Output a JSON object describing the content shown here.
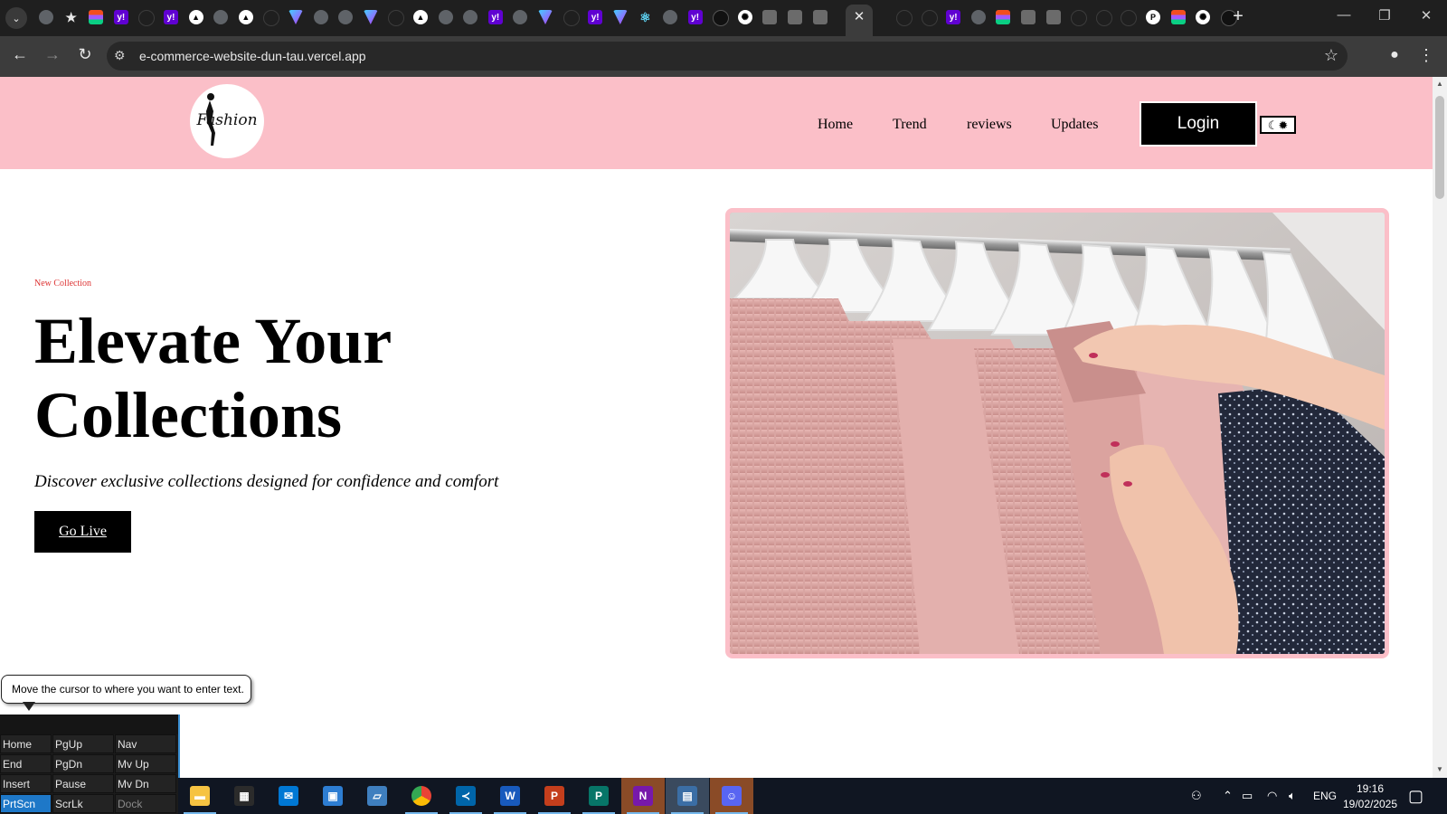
{
  "browser": {
    "url": "e-commerce-website-dun-tau.vercel.app",
    "tab_favicons": [
      "chrome-icon",
      "star-icon",
      "figma-icon",
      "yahoo-icon",
      "blank-icon",
      "yahoo-icon",
      "vercel-icon",
      "chrome-icon",
      "vercel-icon",
      "blank-icon",
      "vite-icon",
      "chrome-icon",
      "chrome-icon",
      "vite-icon",
      "blank-icon",
      "vercel-icon",
      "chrome-icon",
      "chrome-icon",
      "yahoo-icon",
      "chrome-icon",
      "vite-icon",
      "blank-icon",
      "yahoo-icon",
      "vite-icon",
      "react-icon",
      "chrome-icon",
      "yahoo-icon",
      "dark-icon",
      "chatgpt-icon",
      "image-icon",
      "image-icon",
      "image-icon"
    ],
    "tab_favicons_after": [
      "blank-icon",
      "blank-icon",
      "yahoo-icon",
      "chrome-icon",
      "figma-icon",
      "image-icon",
      "image-icon",
      "blank-icon",
      "blank-icon",
      "blank-icon",
      "pix-icon",
      "figma-icon",
      "chatgpt-icon",
      "dark-icon"
    ]
  },
  "header": {
    "logo_text": "Fashion",
    "nav": [
      "Home",
      "Trend",
      "reviews",
      "Updates"
    ],
    "login_label": "Login",
    "theme_icon": "moon-sun-icon"
  },
  "hero": {
    "eyebrow": "New Collection",
    "title": "Elevate Your Collections",
    "subtitle": "Discover exclusive collections designed for confidence and comfort",
    "cta_label": "Go Live"
  },
  "osk": {
    "tooltip": "Move the cursor to where you want to enter text.",
    "keys": [
      [
        "Home",
        "PgUp",
        "Nav"
      ],
      [
        "End",
        "PgDn",
        "Mv Up"
      ],
      [
        "Insert",
        "Pause",
        "Mv Dn"
      ],
      [
        "PrtScn",
        "ScrLk",
        "Dock"
      ]
    ]
  },
  "taskbar": {
    "apps": [
      "file-explorer-icon",
      "store-icon",
      "mail-icon",
      "control-panel-icon",
      "tablet-icon",
      "chrome-icon",
      "vscode-icon",
      "word-icon",
      "powerpoint-icon",
      "publisher-icon",
      "onenote-icon",
      "app-icon",
      "discord-icon"
    ],
    "language": "ENG",
    "time": "19:16",
    "date": "19/02/2025"
  }
}
